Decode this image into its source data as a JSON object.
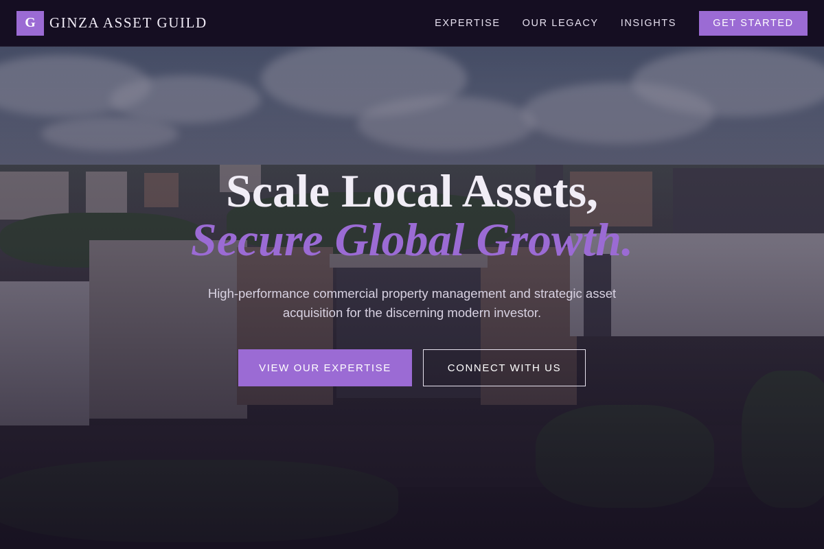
{
  "colors": {
    "accent": "#9b6bd4",
    "nav_background": "#150e22",
    "headline_text": "#f1edf6"
  },
  "brand": {
    "logo_letter": "G",
    "name": "GINZA ASSET GUILD"
  },
  "nav": {
    "links": [
      "EXPERTISE",
      "OUR LEGACY",
      "INSIGHTS"
    ],
    "cta": "GET STARTED"
  },
  "hero": {
    "headline_line1": "Scale Local Assets,",
    "headline_line2": "Secure Global Growth.",
    "subtext": "High-performance commercial property management and strategic asset acquisition for the discerning modern investor.",
    "primary_button": "VIEW OUR EXPERTISE",
    "secondary_button": "CONNECT WITH US",
    "background_image": "aerial-city-commercial-complex"
  }
}
